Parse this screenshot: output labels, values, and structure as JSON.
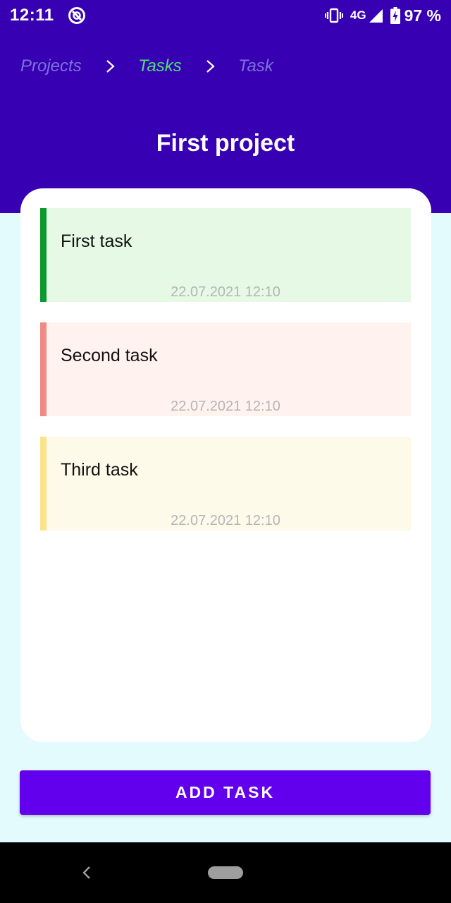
{
  "status_bar": {
    "time": "12:11",
    "network": "4G",
    "battery": "97 %",
    "icons": [
      "app-notification-icon",
      "vibrate-icon",
      "signal-icon",
      "battery-charging-icon"
    ]
  },
  "breadcrumb": {
    "items": [
      "Projects",
      "Tasks",
      "Task"
    ],
    "active_index": 1,
    "active_color": "#4ee07a",
    "inactive_color": "#7c73d9"
  },
  "project": {
    "title": "First project"
  },
  "tasks": [
    {
      "title": "First task",
      "date": "22.07.2021 12:10",
      "accent_color": "#0b9a2f",
      "background": "#e5f9e5"
    },
    {
      "title": "Second task",
      "date": "22.07.2021 12:10",
      "accent_color": "#f08a86",
      "background": "#fff2ef"
    },
    {
      "title": "Third task",
      "date": "22.07.2021 12:10",
      "accent_color": "#fbe38a",
      "background": "#fdfaea"
    }
  ],
  "actions": {
    "add_task_label": "ADD TASK"
  },
  "theme": {
    "header": "#3700b3",
    "button": "#6200ee",
    "page_background": "#e3fbfc"
  },
  "nav_bar": {
    "icons": [
      "back-icon",
      "home-pill-icon"
    ]
  }
}
